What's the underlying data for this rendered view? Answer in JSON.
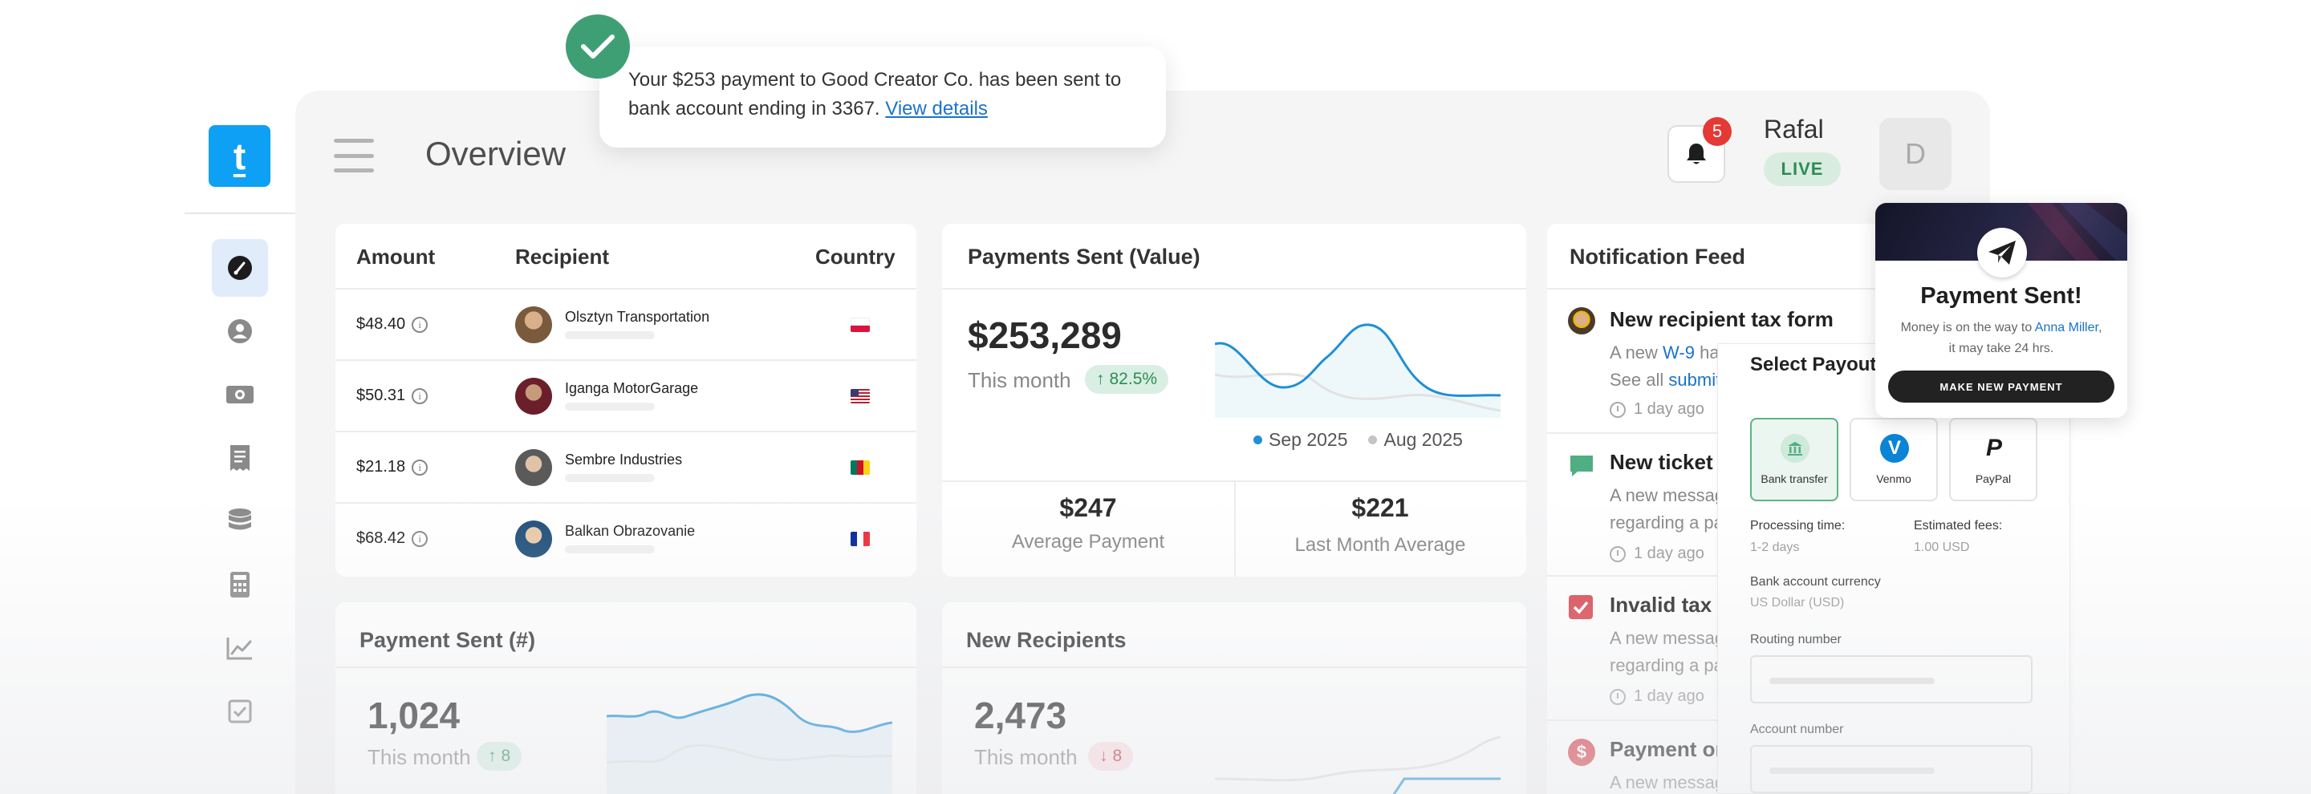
{
  "app": {
    "logo_letter": "t"
  },
  "header": {
    "title": "Overview",
    "notification_count": "5",
    "user_name": "Rafal",
    "status_badge": "LIVE",
    "avatar_initial": "D"
  },
  "sidebar": {
    "items": [
      {
        "icon": "dashboard-icon",
        "active": true
      },
      {
        "icon": "user-icon",
        "active": false
      },
      {
        "icon": "money-icon",
        "active": false
      },
      {
        "icon": "receipt-icon",
        "active": false
      },
      {
        "icon": "database-icon",
        "active": false
      },
      {
        "icon": "calculator-icon",
        "active": false
      },
      {
        "icon": "chart-icon",
        "active": false
      },
      {
        "icon": "checklist-icon",
        "active": false
      }
    ]
  },
  "toast": {
    "message": "Your $253 payment to Good Creator Co. has been sent to bank account ending in 3367.",
    "link": "View details"
  },
  "payments_table": {
    "columns": [
      "Amount",
      "Recipient",
      "Country"
    ],
    "rows": [
      {
        "amount": "$48.40",
        "recipient": "Olsztyn Transportation",
        "country_flag": "poland"
      },
      {
        "amount": "$50.31",
        "recipient": "Iganga MotorGarage",
        "country_flag": "usa"
      },
      {
        "amount": "$21.18",
        "recipient": "Sembre Industries",
        "country_flag": "cameroon"
      },
      {
        "amount": "$68.42",
        "recipient": "Balkan Obrazovanie",
        "country_flag": "france"
      }
    ]
  },
  "payments_value": {
    "title": "Payments Sent (Value)",
    "amount": "$253,289",
    "period": "This month",
    "change": "82.5%",
    "legend": [
      "Sep 2025",
      "Aug 2025"
    ],
    "avg_value": "$247",
    "avg_label": "Average Payment",
    "last_value": "$221",
    "last_label": "Last Month Average"
  },
  "payments_count": {
    "title": "Payment Sent (#)",
    "value": "1,024",
    "period": "This month",
    "change": "8"
  },
  "new_recipients": {
    "title": "New Recipients",
    "value": "2,473",
    "period": "This month",
    "change": "8"
  },
  "feed": {
    "title": "Notification Feed",
    "items": [
      {
        "title": "New recipient tax form",
        "line1_prefix": "A new ",
        "line1_link": "W-9",
        "line1_rest": " ha",
        "line2_prefix": "See all ",
        "line2_link": "submit",
        "time": "1 day ago"
      },
      {
        "title": "New ticket r",
        "line1": "A new messag",
        "line2": "regarding a pa",
        "time": "1 day ago"
      },
      {
        "title": "Invalid tax fo",
        "line1": "A new messag",
        "line2": "regarding a pa",
        "time": "1 day ago"
      },
      {
        "title": "Payment on",
        "line1": "A new messag"
      }
    ]
  },
  "payout": {
    "title": "Select Payout M",
    "methods": [
      "Bank transfer",
      "Venmo",
      "PayPal"
    ],
    "processing_label": "Processing time:",
    "processing_value": "1-2 days",
    "fees_label": "Estimated fees:",
    "fees_value": "1.00 USD",
    "currency_label": "Bank account currency",
    "currency_value": "US Dollar (USD)",
    "routing_label": "Routing number",
    "account_label": "Account number"
  },
  "payment_sent": {
    "title": "Payment Sent!",
    "msg_prefix": "Money is on the way to ",
    "recipient": "Anna Miller",
    "msg_suffix": ",",
    "msg_line2": "it may take 24 hrs.",
    "button": "MAKE NEW PAYMENT"
  },
  "colors": {
    "brand": "#0ea0f5",
    "positive": "#2e8b57",
    "negative": "#c62839",
    "chart_line": "#1f8fd6",
    "toast_check": "#3f9f74"
  }
}
